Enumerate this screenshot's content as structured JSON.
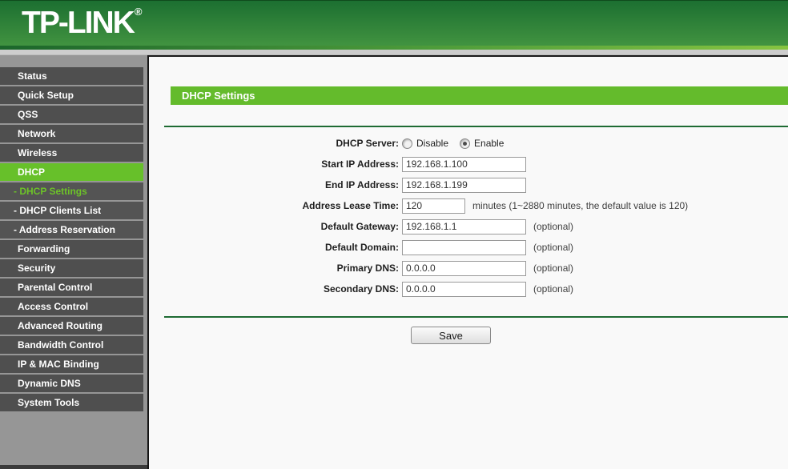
{
  "header": {
    "logo": "TP-LINK",
    "logo_reg": "®"
  },
  "sidebar": {
    "items": [
      {
        "label": "Status",
        "type": "main",
        "active": false
      },
      {
        "label": "Quick Setup",
        "type": "main",
        "active": false
      },
      {
        "label": "QSS",
        "type": "main",
        "active": false
      },
      {
        "label": "Network",
        "type": "main",
        "active": false
      },
      {
        "label": "Wireless",
        "type": "main",
        "active": false
      },
      {
        "label": "DHCP",
        "type": "main",
        "active": true
      },
      {
        "label": "- DHCP Settings",
        "type": "sub",
        "active": true
      },
      {
        "label": "- DHCP Clients List",
        "type": "sub",
        "active": false
      },
      {
        "label": "- Address Reservation",
        "type": "sub",
        "active": false
      },
      {
        "label": "Forwarding",
        "type": "main",
        "active": false
      },
      {
        "label": "Security",
        "type": "main",
        "active": false
      },
      {
        "label": "Parental Control",
        "type": "main",
        "active": false
      },
      {
        "label": "Access Control",
        "type": "main",
        "active": false
      },
      {
        "label": "Advanced Routing",
        "type": "main",
        "active": false
      },
      {
        "label": "Bandwidth Control",
        "type": "main",
        "active": false
      },
      {
        "label": "IP & MAC Binding",
        "type": "main",
        "active": false
      },
      {
        "label": "Dynamic DNS",
        "type": "main",
        "active": false
      },
      {
        "label": "System Tools",
        "type": "main",
        "active": false
      }
    ]
  },
  "main": {
    "title": "DHCP Settings",
    "form": {
      "dhcp_server": {
        "label": "DHCP Server:",
        "options": [
          {
            "label": "Disable",
            "selected": false
          },
          {
            "label": "Enable",
            "selected": true
          }
        ]
      },
      "fields": [
        {
          "label": "Start IP Address:",
          "value": "192.168.1.100",
          "note": "",
          "small": false
        },
        {
          "label": "End IP Address:",
          "value": "192.168.1.199",
          "note": "",
          "small": false
        },
        {
          "label": "Address Lease Time:",
          "value": "120",
          "note": "minutes (1~2880 minutes, the default value is 120)",
          "small": true
        },
        {
          "label": "Default Gateway:",
          "value": "192.168.1.1",
          "note": "(optional)",
          "small": false
        },
        {
          "label": "Default Domain:",
          "value": "",
          "note": "(optional)",
          "small": false
        },
        {
          "label": "Primary DNS:",
          "value": "0.0.0.0",
          "note": "(optional)",
          "small": false
        },
        {
          "label": "Secondary DNS:",
          "value": "0.0.0.0",
          "note": "(optional)",
          "small": false
        }
      ],
      "save_label": "Save"
    }
  },
  "colors": {
    "accent_green": "#67C02A",
    "title_bar_green": "#64BB2C",
    "header_gradient_top": "#1C6F31",
    "header_gradient_bottom": "#419340",
    "header_strip_bright": "#86C440",
    "sidebar_bg": "#969696",
    "menu_item_bg": "#4F4F4F",
    "sub_active_text": "#6DC328",
    "separator_green": "#1E6B33",
    "content_bg": "#F9F9F9"
  }
}
